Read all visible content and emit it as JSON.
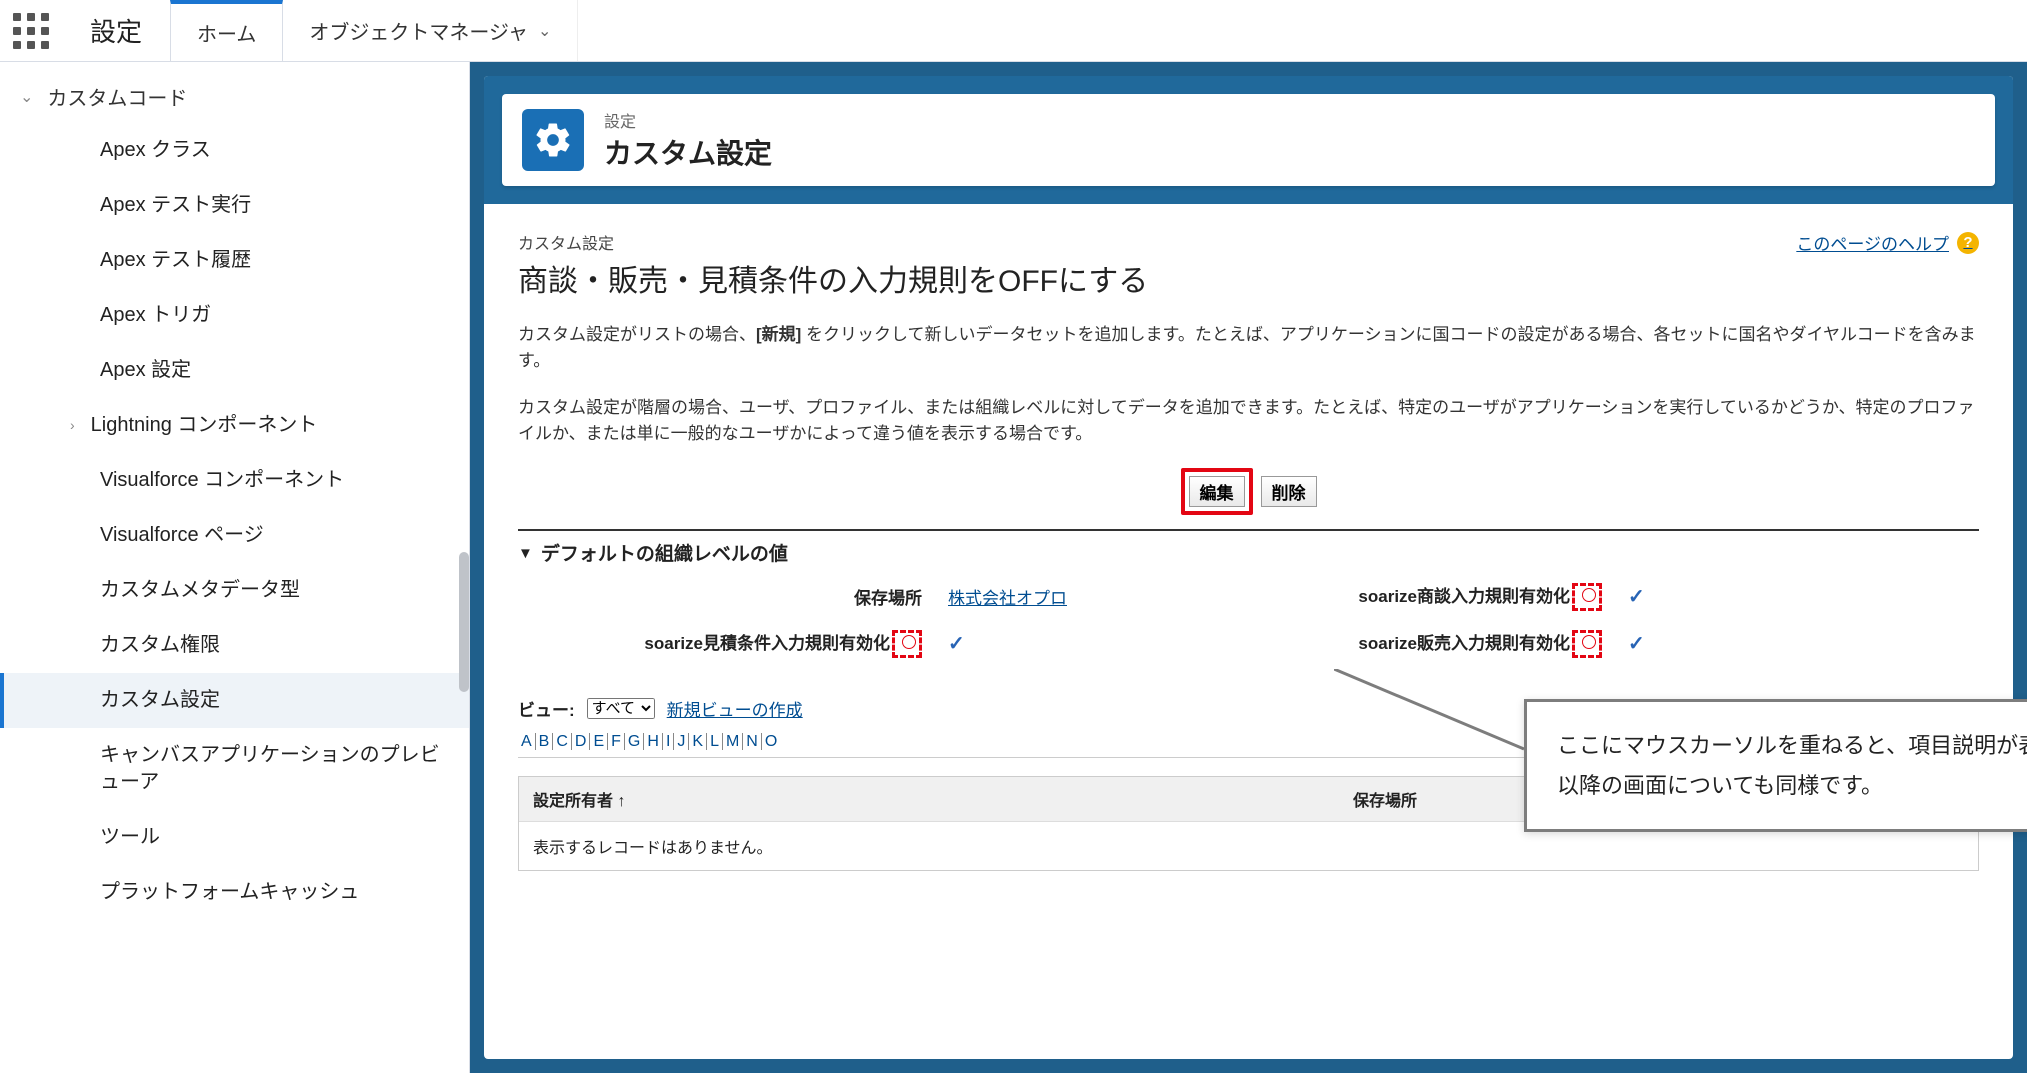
{
  "topbar": {
    "app_name": "設定",
    "tabs": [
      {
        "label": "ホーム",
        "active": true
      },
      {
        "label": "オブジェクトマネージャ",
        "active": false,
        "dropdown": true
      }
    ]
  },
  "sidebar": {
    "group_label": "カスタムコード",
    "items": [
      {
        "label": "Apex クラス"
      },
      {
        "label": "Apex テスト実行"
      },
      {
        "label": "Apex テスト履歴"
      },
      {
        "label": "Apex トリガ"
      },
      {
        "label": "Apex 設定"
      },
      {
        "label": "Lightning コンポーネント",
        "expandable": true
      },
      {
        "label": "Visualforce コンポーネント"
      },
      {
        "label": "Visualforce ページ"
      },
      {
        "label": "カスタムメタデータ型"
      },
      {
        "label": "カスタム権限"
      },
      {
        "label": "カスタム設定",
        "selected": true
      },
      {
        "label": "キャンバスアプリケーションのプレビューア"
      },
      {
        "label": "ツール"
      },
      {
        "label": "プラットフォームキャッシュ"
      }
    ]
  },
  "page_header": {
    "crumb": "設定",
    "title": "カスタム設定"
  },
  "content": {
    "crumb_small": "カスタム設定",
    "title": "商談・販売・見積条件の入力規則をOFFにする",
    "help_link": "このページのヘルプ",
    "desc1_a": "カスタム設定がリストの場合、",
    "desc1_b": "[新規]",
    "desc1_c": " をクリックして新しいデータセットを追加します。たとえば、アプリケーションに国コードの設定がある場合、各セットに国名やダイヤルコードを含みます。",
    "desc2": "カスタム設定が階層の場合、ユーザ、プロファイル、または組織レベルに対してデータを追加できます。たとえば、特定のユーザがアプリケーションを実行しているかどうか、特定のプロファイルか、または単に一般的なユーザかによって違う値を表示する場合です。",
    "btn_edit": "編集",
    "btn_delete": "削除",
    "section_title": "デフォルトの組織レベルの値",
    "rows": {
      "loc_label": "保存場所",
      "loc_value": "株式会社オプロ",
      "r1_label": "soarize商談入力規則有効化",
      "r2_label": "soarize見積条件入力規則有効化",
      "r3_label": "soarize販売入力規則有効化"
    },
    "view_label": "ビュー:",
    "view_select": "すべて",
    "view_new_link": "新規ビューの作成",
    "alpha": [
      "A",
      "B",
      "C",
      "D",
      "E",
      "F",
      "G",
      "H",
      "I",
      "J",
      "K",
      "L",
      "M",
      "N",
      "O"
    ],
    "list": {
      "col1": "設定所有者",
      "sort_indicator": "↑",
      "col2": "保存場所",
      "empty": "表示するレコードはありません。"
    }
  },
  "callout": {
    "line1": "ここにマウスカーソルを重ねると、項目説明が表示されます。",
    "line2": "以降の画面についても同様です。"
  }
}
